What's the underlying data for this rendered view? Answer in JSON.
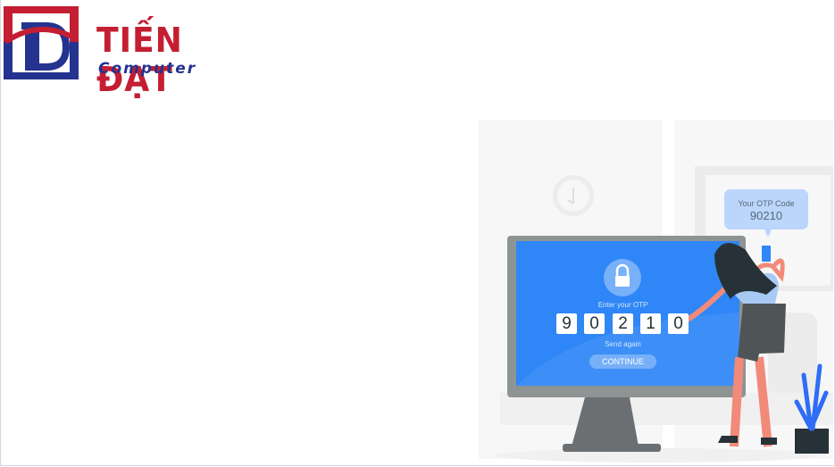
{
  "logo": {
    "name": "TIẾN ĐẠT",
    "subtitle": "Computer"
  },
  "illustration": {
    "screen_title": "Enter your OTP",
    "otp_digits": [
      "9",
      "0",
      "2",
      "1",
      "0"
    ],
    "send_again": "Send again",
    "continue_label": "CONTINUE",
    "phone_bubble_title": "Your OTP Code",
    "phone_bubble_code": "90210"
  },
  "colors": {
    "brand_red": "#c41e32",
    "brand_blue": "#23338f",
    "screen_blue": "#2f86f6"
  }
}
